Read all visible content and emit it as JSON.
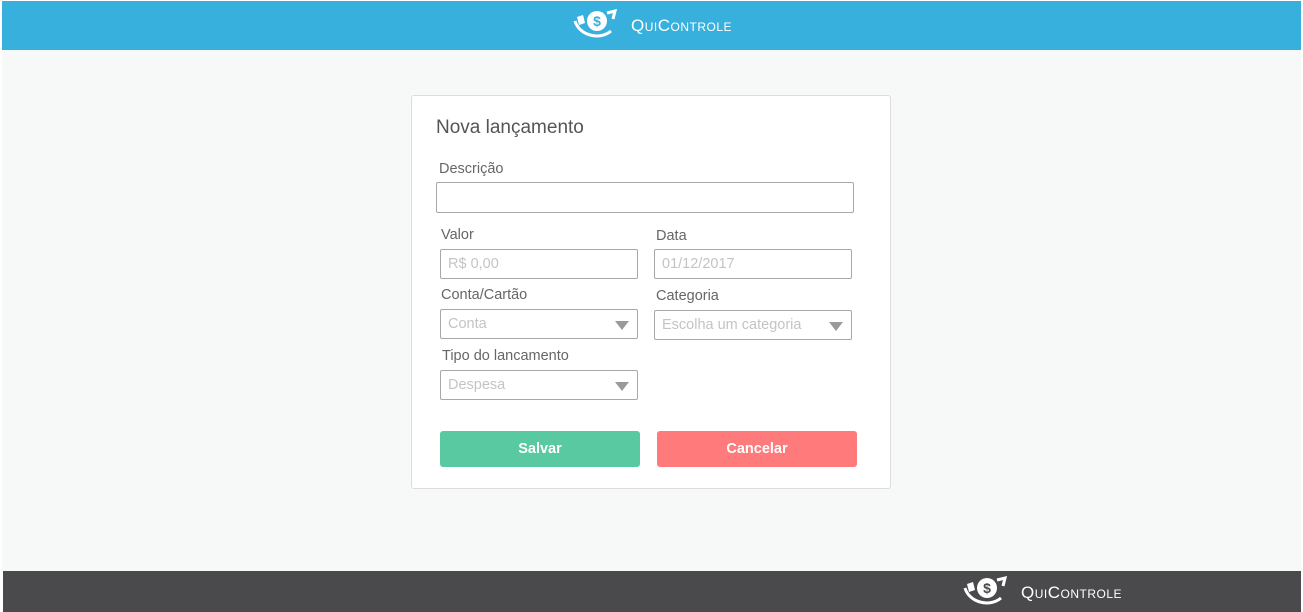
{
  "header": {
    "brand": "QuiControle",
    "logo_icon": "money-hand-logo-icon"
  },
  "form": {
    "title": "Nova lançamento",
    "descricao": {
      "label": "Descrição",
      "value": ""
    },
    "valor": {
      "label": "Valor",
      "placeholder": "R$ 0,00"
    },
    "data": {
      "label": "Data",
      "placeholder": "01/12/2017"
    },
    "conta": {
      "label": "Conta/Cartão",
      "selected": "Conta"
    },
    "categoria": {
      "label": "Categoria",
      "selected": "Escolha um categoria"
    },
    "tipo": {
      "label": "Tipo do lancamento",
      "selected": "Despesa"
    },
    "save_label": "Salvar",
    "cancel_label": "Cancelar"
  },
  "footer": {
    "brand": "QuiControle"
  },
  "colors": {
    "header": "#38b0de",
    "save": "#58c9a1",
    "cancel": "#ff7a7a",
    "footer": "#4a4a4c",
    "background": "#f6f9f8"
  }
}
